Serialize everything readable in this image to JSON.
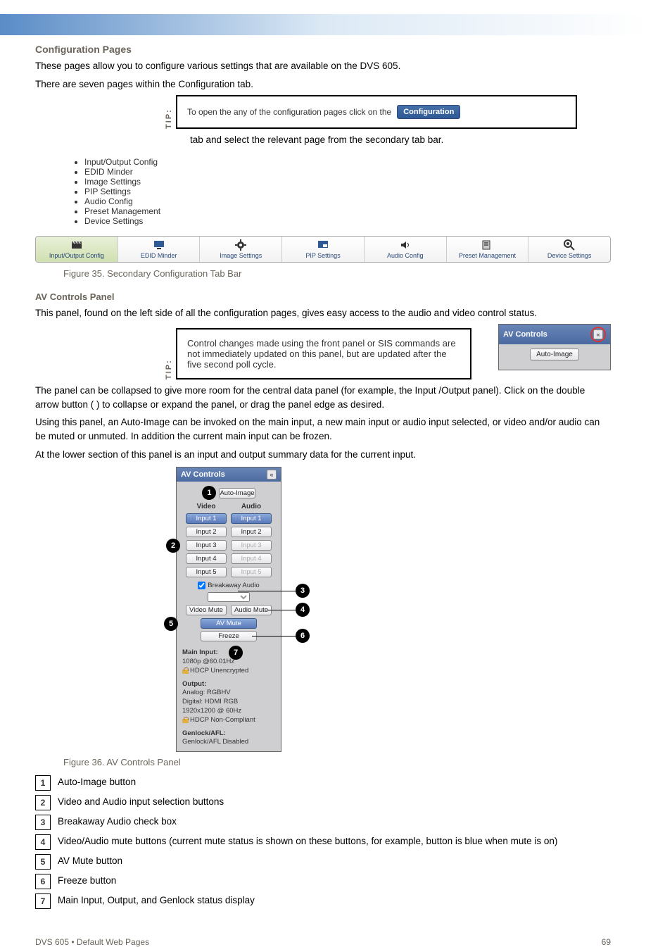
{
  "header": {
    "heading_main": "Configuration Pages",
    "intro_1": "These pages allow you to configure various settings that are available on the DVS 605.",
    "intro_2": "There are seven pages within the Configuration tab.",
    "tip_text1": "To open the any of the configuration pages click on the ",
    "tip_text2": " tab and select the relevant page from the secondary tab bar."
  },
  "config_button_label": "Configuration",
  "tabs": [
    {
      "label": "Input/Output Config",
      "active": true
    },
    {
      "label": "EDID Minder",
      "active": false
    },
    {
      "label": "Image Settings",
      "active": false
    },
    {
      "label": "PIP Settings",
      "active": false
    },
    {
      "label": "Audio Config",
      "active": false
    },
    {
      "label": "Preset Management",
      "active": false
    },
    {
      "label": "Device Settings",
      "active": false
    }
  ],
  "tab_caption": "Figure 35.   Secondary Configuration Tab Bar",
  "heading_av": "AV Controls Panel",
  "av_intro": "This panel, found on the left side of all the configuration pages, gives easy access to the audio and video control status.",
  "av_tip": "Control changes made using the front panel or SIS commands are not immediately updated on this panel, but are updated after the five second poll cycle.",
  "av_body_1": "The panel can be collapsed to give more room for the central data panel (for example, the Input /Output panel). Click on the double arrow button ( ) to collapse or expand the panel, or drag the panel edge as desired.",
  "av_body_2": "Using this panel, an Auto-Image can be invoked on the main input, a new main input or audio input selected, or video and/or audio can be muted or unmuted. In addition the current main input can be frozen.",
  "av_body_3": "At the lower section of this panel is an input and output summary data for the current input.",
  "figure36": "Figure 36.   AV Controls Panel",
  "right_mini_panel": {
    "title": "AV Controls",
    "auto_image": "Auto-Image"
  },
  "av_panel": {
    "title": "AV Controls",
    "auto_image": "Auto-Image",
    "col_video": "Video",
    "col_audio": "Audio",
    "inputs": [
      "Input 1",
      "Input 2",
      "Input 3",
      "Input 4",
      "Input 5"
    ],
    "breakaway": "Breakaway Audio",
    "video_mute": "Video Mute",
    "audio_mute": "Audio Mute",
    "av_mute": "AV Mute",
    "freeze": "Freeze",
    "main_input_hdr": "Main Input:",
    "main_rate": "1080p @60.01Hz",
    "hdcp_unenc": "HDCP Unencrypted",
    "output_hdr": "Output:",
    "analog": "Analog: RGBHV",
    "digital": "Digital: HDMI RGB",
    "out_res": "1920x1200 @ 60Hz",
    "hdcp_nc": "HDCP Non-Compliant",
    "genlock_hdr": "Genlock/AFL:",
    "genlock_state": "Genlock/AFL Disabled"
  },
  "callouts": {
    "1": "Auto-Image button",
    "2": "Video and Audio input selection buttons",
    "3": "Breakaway Audio check box",
    "4": "Video/Audio mute buttons",
    "5": "AV Mute button",
    "6": "Freeze button",
    "7": "Main Input, Output, and Genlock status display",
    "instr4_suffix": " (current mute status is shown on these buttons, for example, button is blue when mute is on)"
  },
  "footer": {
    "left": "DVS 605 • Default Web Pages",
    "right": "69"
  }
}
